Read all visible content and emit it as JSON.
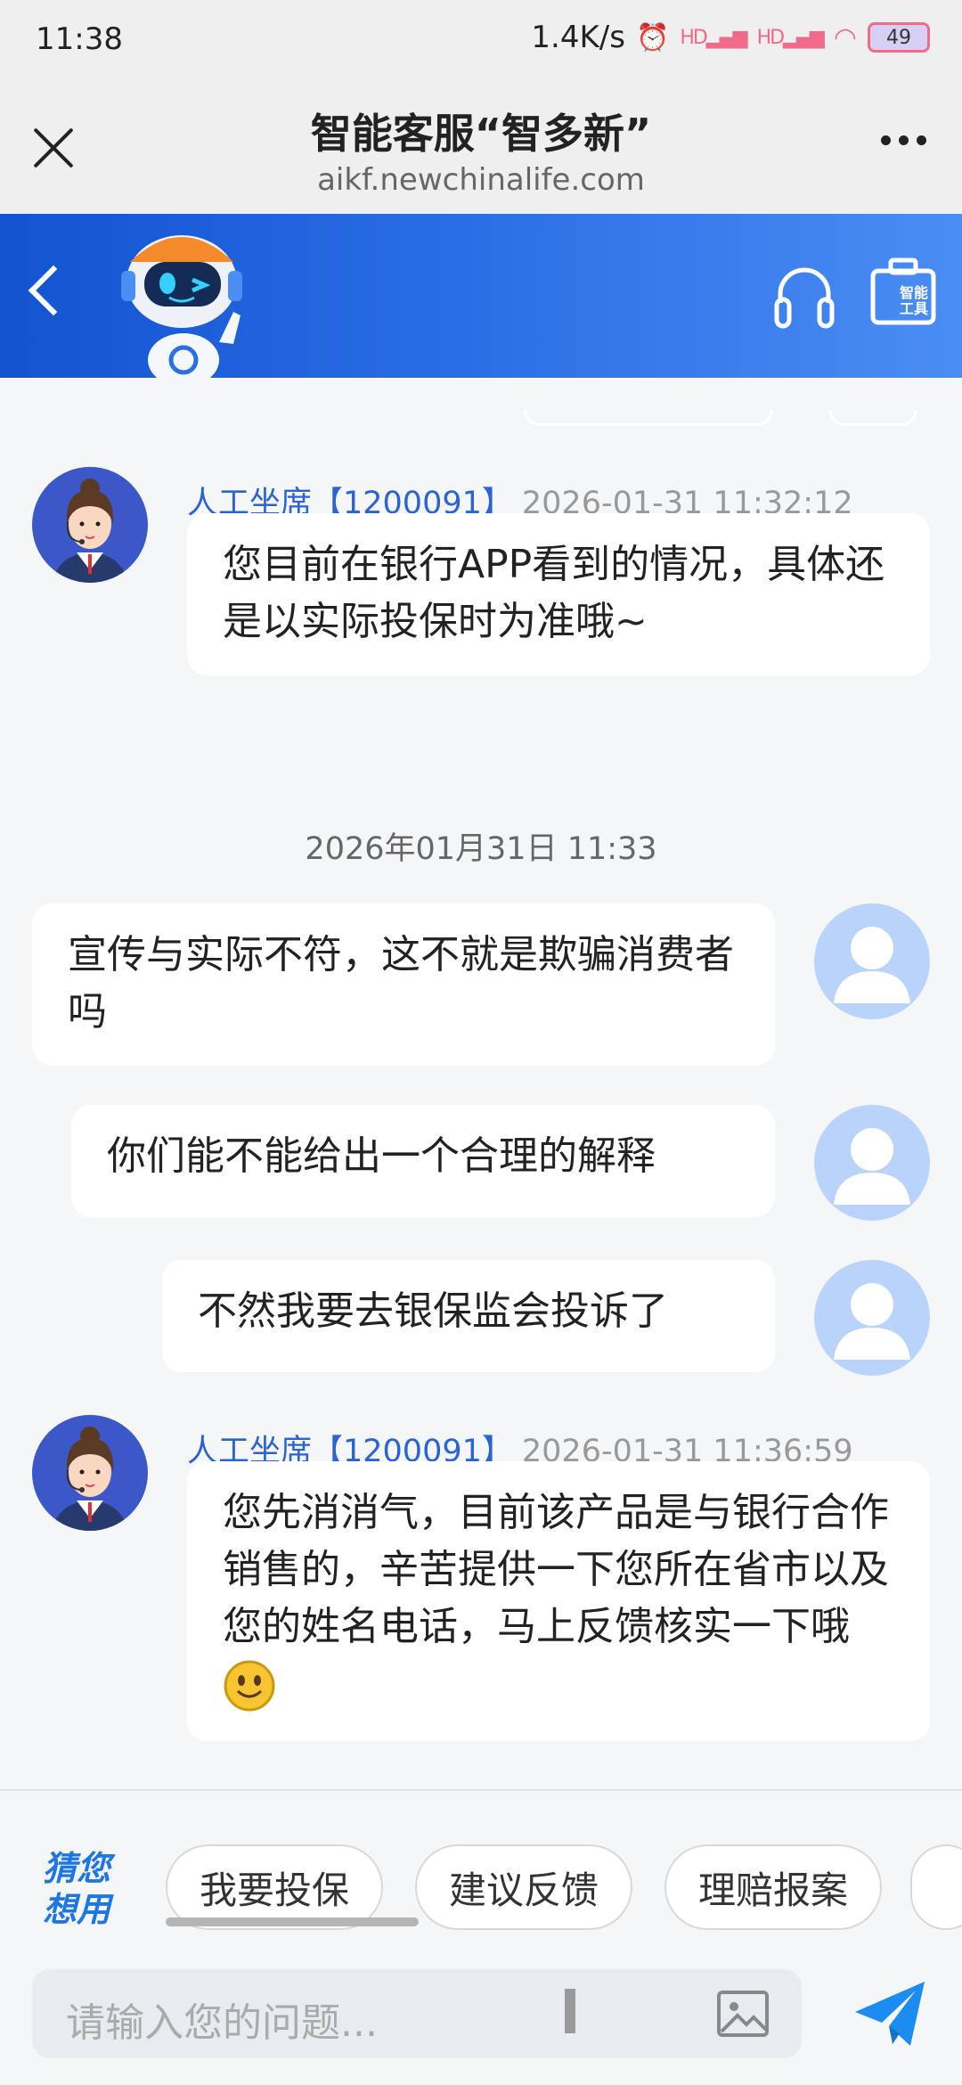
{
  "status_bar": {
    "time": "11:38",
    "net_speed": "1.4K/s",
    "alarm_icon": "alarm-icon",
    "signal_1": "HD",
    "signal_2": "HD",
    "battery": "49"
  },
  "browser": {
    "title": "智能客服“智多新”",
    "url": "aikf.newchinalife.com"
  },
  "header": {
    "tools_label": "智能工具",
    "accent_color": "#2b6fe6"
  },
  "messages": [
    {
      "sender": "人工坐席【1200091】",
      "time": "2026-01-31 11:32:12",
      "text": "您目前在银行APP看到的情况，具体还是以实际投保时为准哦~"
    },
    {
      "date_divider": "2026年01月31日 11:33"
    },
    {
      "text": "宣传与实际不符，这不就是欺骗消费者吗"
    },
    {
      "text": "你们能不能给出一个合理的解释"
    },
    {
      "text": "不然我要去银保监会投诉了"
    },
    {
      "sender": "人工坐席【1200091】",
      "time": "2026-01-31 11:36:59",
      "text": "您先消消气，目前该产品是与银行合作销售的，辛苦提供一下您所在省市以及您的姓名电话，马上反馈核实一下哦"
    }
  ],
  "quick": {
    "guess_label": "猜您想用",
    "chips": [
      "我要投保",
      "建议反馈",
      "理赔报案"
    ]
  },
  "input": {
    "placeholder": "请输入您的问题..."
  }
}
